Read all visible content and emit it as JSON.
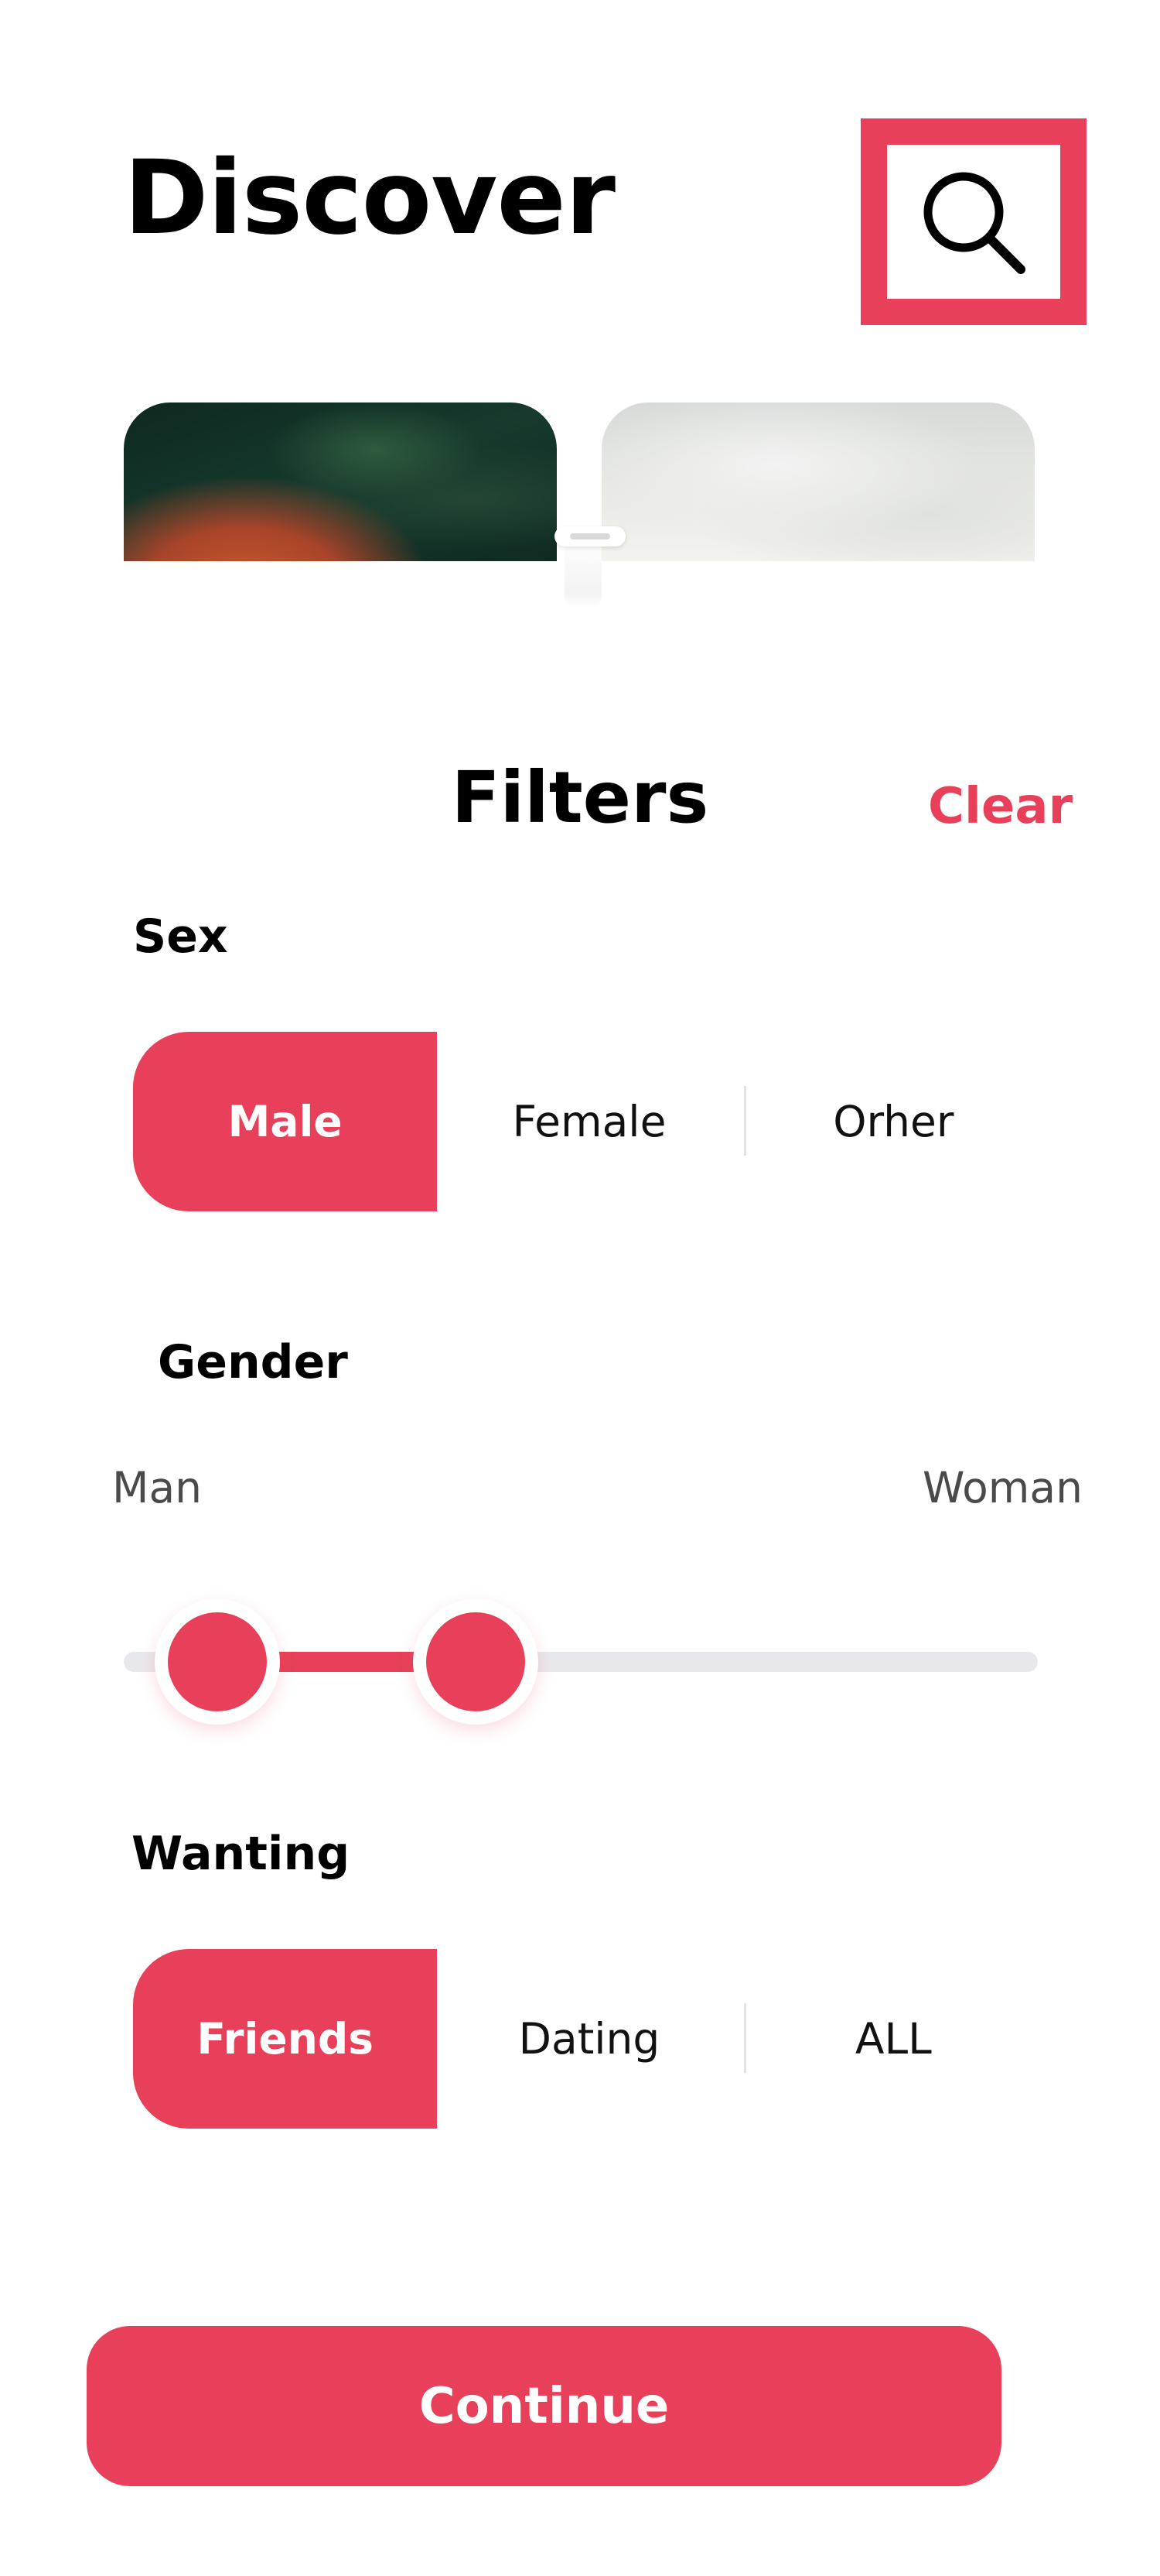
{
  "header": {
    "title": "Discover"
  },
  "icons": {
    "search": "search-icon"
  },
  "filters": {
    "title": "Filters",
    "clear_label": "Clear",
    "sex": {
      "label": "Sex",
      "options": [
        "Male",
        "Female",
        "Orher"
      ],
      "selected": "Male"
    },
    "gender": {
      "label": "Gender",
      "min_label": "Man",
      "max_label": "Woman",
      "range_low": 0.1,
      "range_high": 0.39
    },
    "wanting": {
      "label": "Wanting",
      "options": [
        "Friends",
        "Dating",
        "ALL"
      ],
      "selected": "Friends"
    }
  },
  "actions": {
    "continue_label": "Continue"
  },
  "colors": {
    "accent": "#E8405A",
    "track": "#E8E8EC",
    "background": "#FFFFFF"
  }
}
